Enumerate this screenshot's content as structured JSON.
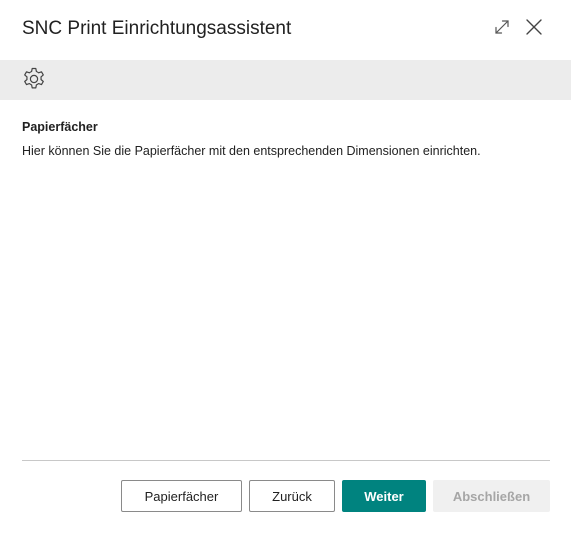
{
  "dialog": {
    "title": "SNC Print Einrichtungsassistent",
    "icons": {
      "expand": "expand-icon",
      "close": "close-icon",
      "settings": "gear-icon"
    }
  },
  "content": {
    "section_title": "Papierfächer",
    "section_description": "Hier können Sie die Papierfächer mit den entsprechenden Dimensionen einrichten."
  },
  "footer": {
    "buttons": {
      "papierfaecher": "Papierfächer",
      "zurueck": "Zurück",
      "weiter": "Weiter",
      "abschliessen": "Abschließen"
    }
  },
  "colors": {
    "primary": "#00837f",
    "toolbar_bg": "#ececec",
    "disabled_bg": "#f0f0f0",
    "disabled_text": "#a6a6a6"
  }
}
